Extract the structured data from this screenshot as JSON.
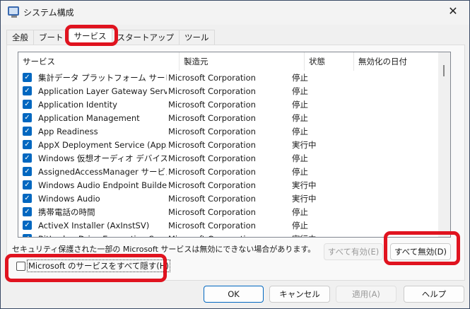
{
  "window": {
    "title": "システム構成",
    "close": "✕"
  },
  "tabs": [
    "全般",
    "ブート",
    "サービス",
    "スタートアップ",
    "ツール"
  ],
  "active_tab": "サービス",
  "columns": [
    "サービス",
    "製造元",
    "状態",
    "無効化の日付"
  ],
  "rows": [
    {
      "name": "集計データ プラットフォーム サービス",
      "maker": "Microsoft Corporation",
      "status": "停止",
      "checked": true
    },
    {
      "name": "Application Layer Gateway Service",
      "maker": "Microsoft Corporation",
      "status": "停止",
      "checked": true
    },
    {
      "name": "Application Identity",
      "maker": "Microsoft Corporation",
      "status": "停止",
      "checked": true
    },
    {
      "name": "Application Management",
      "maker": "Microsoft Corporation",
      "status": "停止",
      "checked": true
    },
    {
      "name": "App Readiness",
      "maker": "Microsoft Corporation",
      "status": "停止",
      "checked": true
    },
    {
      "name": "AppX Deployment Service (AppXSVC)",
      "maker": "Microsoft Corporation",
      "status": "実行中",
      "checked": true
    },
    {
      "name": "Windows 仮想オーディオ デバイス プロキ...",
      "maker": "Microsoft Corporation",
      "status": "停止",
      "checked": true
    },
    {
      "name": "AssignedAccessManager サービス",
      "maker": "Microsoft Corporation",
      "status": "停止",
      "checked": true
    },
    {
      "name": "Windows Audio Endpoint Builder",
      "maker": "Microsoft Corporation",
      "status": "実行中",
      "checked": true
    },
    {
      "name": "Windows Audio",
      "maker": "Microsoft Corporation",
      "status": "実行中",
      "checked": true
    },
    {
      "name": "携帯電話の時間",
      "maker": "Microsoft Corporation",
      "status": "停止",
      "checked": true
    },
    {
      "name": "ActiveX Installer (AxInstSV)",
      "maker": "Microsoft Corporation",
      "status": "停止",
      "checked": true
    },
    {
      "name": "BitLocker Drive Encryption Service",
      "maker": "Microsoft Corporation",
      "status": "実行中",
      "checked": true
    }
  ],
  "note": "セキュリティ保護された一部の Microsoft サービスは無効にできない場合があります。",
  "buttons": {
    "enable_all": "すべて有効(E)",
    "disable_all": "すべて無効(D)",
    "ok": "OK",
    "cancel": "キャンセル",
    "apply": "適用(A)",
    "help": "ヘルプ"
  },
  "hide_ms": {
    "label": "Microsoft のサービスをすべて隠す(H)",
    "checked": false
  }
}
